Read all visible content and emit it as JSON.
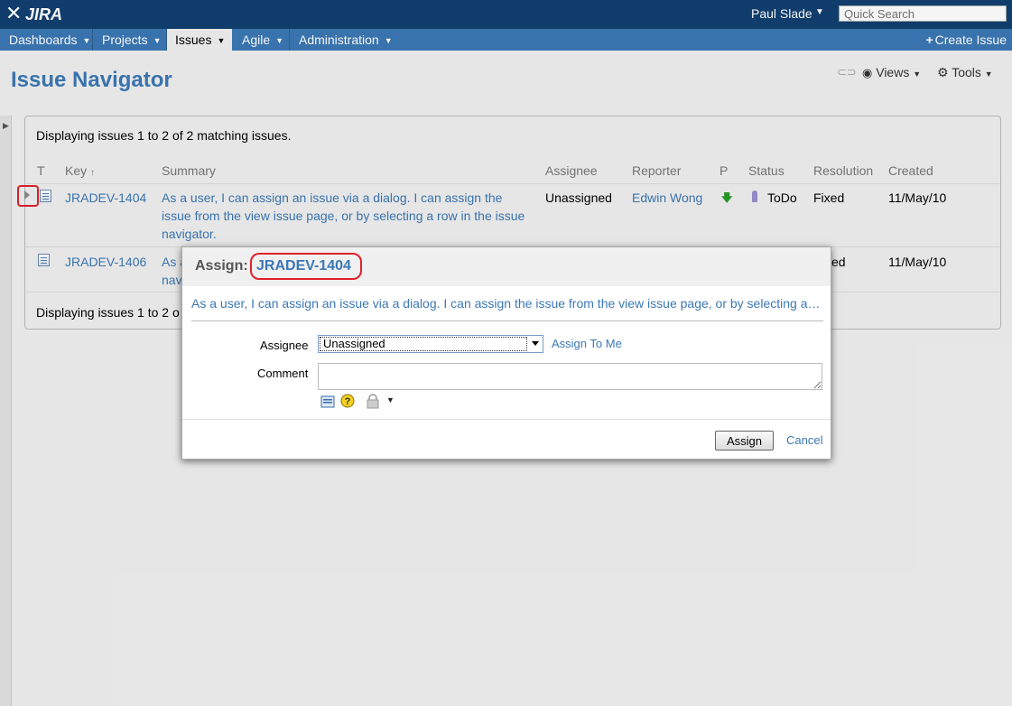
{
  "header": {
    "logo_text": "JIRA",
    "user_name": "Paul Slade",
    "quick_search_placeholder": "Quick Search"
  },
  "nav": {
    "items": [
      {
        "label": "Dashboards"
      },
      {
        "label": "Projects"
      },
      {
        "label": "Issues"
      },
      {
        "label": "Agile"
      },
      {
        "label": "Administration"
      }
    ],
    "active": "Issues",
    "create_label": "Create Issue"
  },
  "page": {
    "title": "Issue Navigator",
    "views_label": "Views",
    "tools_label": "Tools"
  },
  "results": {
    "summary_top": "Displaying issues 1 to 2 of 2 matching issues.",
    "summary_bottom": "Displaying issues 1 to 2 o",
    "columns": [
      "T",
      "Key",
      "Summary",
      "Assignee",
      "Reporter",
      "P",
      "Status",
      "Resolution",
      "Created"
    ],
    "sort_indicator": "↑",
    "rows": [
      {
        "key": "JRADEV-1404",
        "summary_lines": [
          "As a user, I can assign an issue via a dialog. I can assign the",
          "issue from the view issue page, or by selecting a row in the issue",
          "navigator."
        ],
        "assignee": "Unassigned",
        "reporter": "Edwin Wong",
        "status": "ToDo",
        "resolution": "Fixed",
        "created": "11/May/10"
      },
      {
        "key": "JRADEV-1406",
        "summary_lines": [
          "As a",
          "navi"
        ],
        "resolution_partial": "ed",
        "created": "11/May/10"
      }
    ]
  },
  "dialog": {
    "title_prefix": "Assign:",
    "issue_key": "JRADEV-1404",
    "summary": "As a user, I can assign an issue via a dialog. I can assign the issue from the view issue page, or by selecting a row in the issue navigator.",
    "assignee_label": "Assignee",
    "assignee_value": "Unassigned",
    "assign_to_me": "Assign To Me",
    "comment_label": "Comment",
    "assign_button": "Assign",
    "cancel_link": "Cancel"
  },
  "colors": {
    "header_bg": "#114070",
    "nav_bg": "#3c78b5",
    "link": "#3c78b5",
    "highlight": "#e0212d"
  }
}
